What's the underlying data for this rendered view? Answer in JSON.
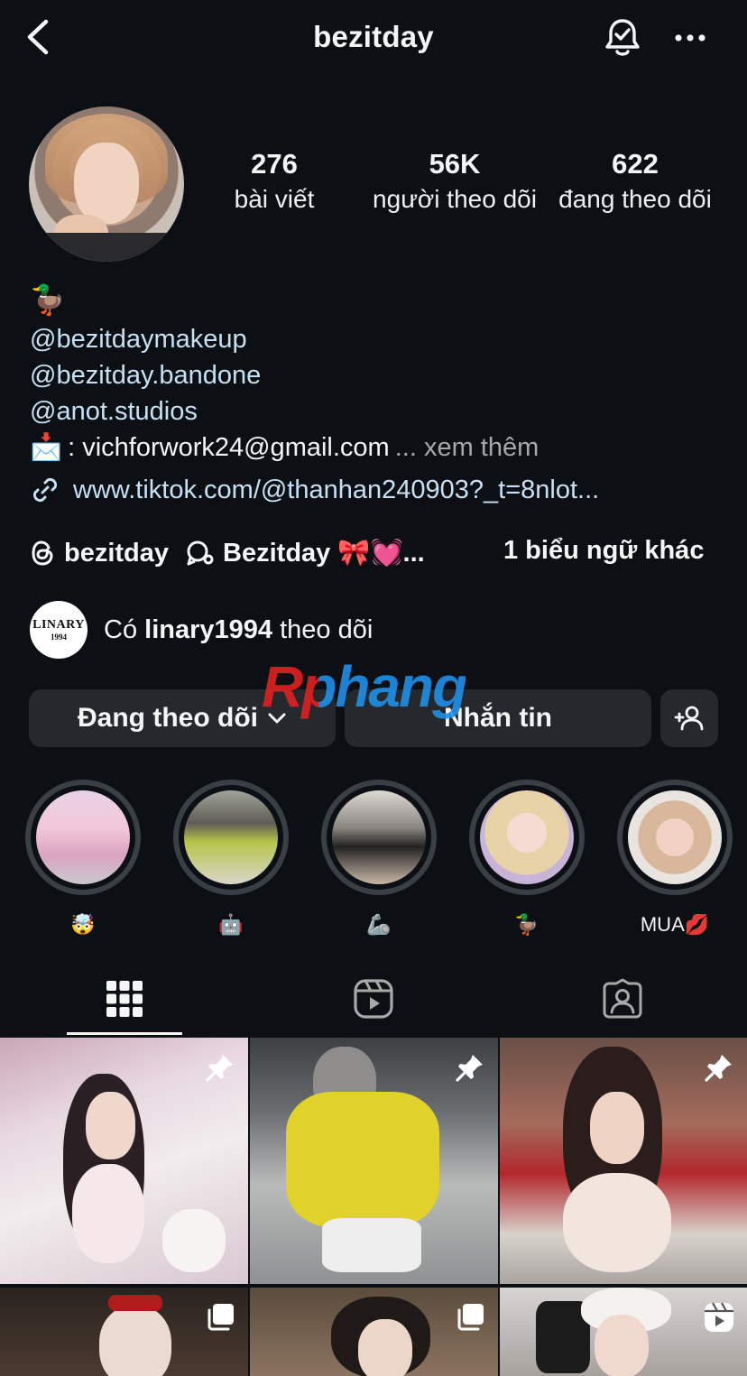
{
  "header": {
    "username": "bezitday",
    "icons": [
      "back-chevron-icon",
      "bell-check-icon",
      "more-dots-icon"
    ]
  },
  "stats": {
    "posts": {
      "count": "276",
      "label": "bài viết"
    },
    "followers": {
      "count": "56K",
      "label": "người theo dõi"
    },
    "following": {
      "count": "622",
      "label": "đang theo dõi"
    }
  },
  "bio": {
    "emoji": "🦆",
    "mentions": [
      "@bezitdaymakeup",
      "@bezitday.bandone",
      "@anot.studios"
    ],
    "email_emoji": "📩",
    "email_text": ": vichforwork24@gmail.com",
    "more_label": "... xem thêm",
    "link": "www.tiktok.com/@thanhan240903?_t=8nlot..."
  },
  "tags": {
    "threads": "bezitday",
    "broadcast": "Bezitday 🎀💓...",
    "more": "1 biểu ngữ khác"
  },
  "followed_by": {
    "avatar_line1": "LINARY",
    "avatar_line2": "1994",
    "prefix": "Có ",
    "user": "linary1994",
    "suffix": " theo dõi"
  },
  "watermark": "Rphang",
  "actions": {
    "following_label": "Đang theo dõi",
    "message_label": "Nhắn tin"
  },
  "highlights": [
    {
      "label": "🤯"
    },
    {
      "label": "🤖"
    },
    {
      "label": "🦾"
    },
    {
      "label": "🦆"
    },
    {
      "label": "MUA💋"
    }
  ],
  "tabs": [
    "posts-grid",
    "reels",
    "tagged"
  ],
  "grid": {
    "badges": [
      "pin-icon",
      "pin-icon",
      "pin-icon",
      "carousel-icon",
      "carousel-icon",
      "reels-icon"
    ]
  },
  "colors": {
    "background": "#0c1014",
    "button": "#25292e",
    "link": "#c7e0f4"
  }
}
